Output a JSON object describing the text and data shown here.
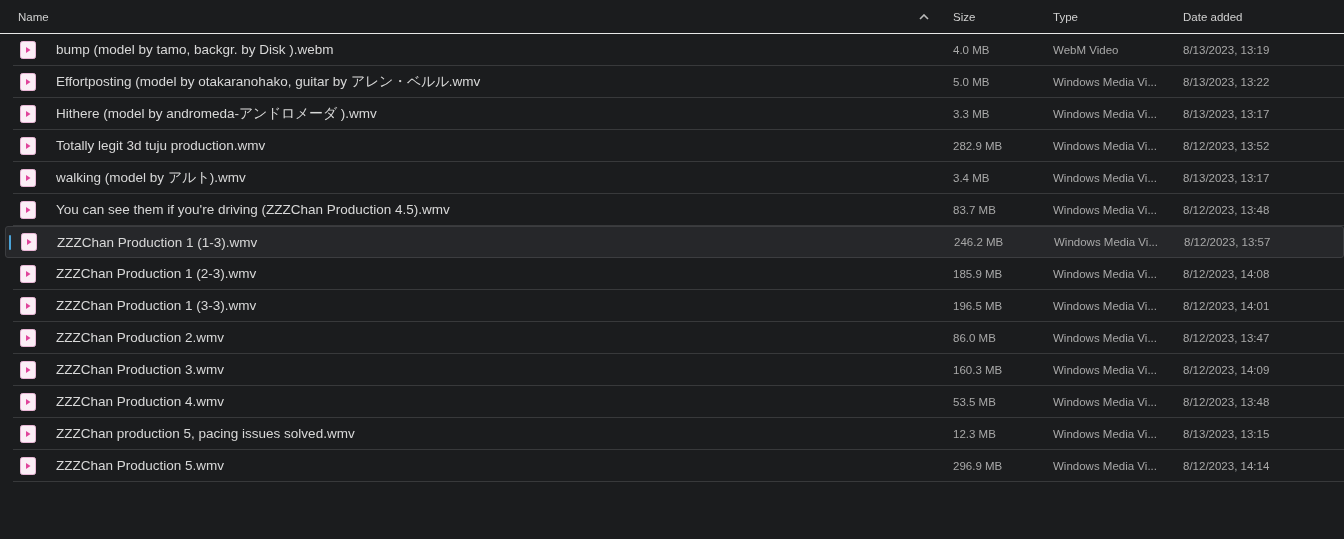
{
  "table": {
    "columns": [
      {
        "label": "Name",
        "sorted": true
      },
      {
        "label": "Size",
        "sorted": false
      },
      {
        "label": "Type",
        "sorted": false
      },
      {
        "label": "Date added",
        "sorted": false
      }
    ],
    "rows": [
      {
        "name": "bump (model by tamo, backgr. by Disk ).webm",
        "size": "4.0 MB",
        "type": "WebM Video",
        "date": "8/13/2023, 13:19",
        "selected": false
      },
      {
        "name": "Effortposting (model by otakaranohako, guitar by アレン・ベルル.wmv",
        "size": "5.0 MB",
        "type": "Windows Media Vi...",
        "date": "8/13/2023, 13:22",
        "selected": false
      },
      {
        "name": "Hithere (model by andromeda-アンドロメーダ ).wmv",
        "size": "3.3 MB",
        "type": "Windows Media Vi...",
        "date": "8/13/2023, 13:17",
        "selected": false
      },
      {
        "name": "Totally legit 3d tuju production.wmv",
        "size": "282.9 MB",
        "type": "Windows Media Vi...",
        "date": "8/12/2023, 13:52",
        "selected": false
      },
      {
        "name": "walking (model by アルト).wmv",
        "size": "3.4 MB",
        "type": "Windows Media Vi...",
        "date": "8/13/2023, 13:17",
        "selected": false
      },
      {
        "name": "You can see them if you're driving (ZZZChan Production 4.5).wmv",
        "size": "83.7 MB",
        "type": "Windows Media Vi...",
        "date": "8/12/2023, 13:48",
        "selected": false
      },
      {
        "name": "ZZZChan Production 1 (1-3).wmv",
        "size": "246.2 MB",
        "type": "Windows Media Vi...",
        "date": "8/12/2023, 13:57",
        "selected": true
      },
      {
        "name": "ZZZChan Production 1 (2-3).wmv",
        "size": "185.9 MB",
        "type": "Windows Media Vi...",
        "date": "8/12/2023, 14:08",
        "selected": false
      },
      {
        "name": "ZZZChan Production 1 (3-3).wmv",
        "size": "196.5 MB",
        "type": "Windows Media Vi...",
        "date": "8/12/2023, 14:01",
        "selected": false
      },
      {
        "name": "ZZZChan Production 2.wmv",
        "size": "86.0 MB",
        "type": "Windows Media Vi...",
        "date": "8/12/2023, 13:47",
        "selected": false
      },
      {
        "name": "ZZZChan Production 3.wmv",
        "size": "160.3 MB",
        "type": "Windows Media Vi...",
        "date": "8/12/2023, 14:09",
        "selected": false
      },
      {
        "name": "ZZZChan Production 4.wmv",
        "size": "53.5 MB",
        "type": "Windows Media Vi...",
        "date": "8/12/2023, 13:48",
        "selected": false
      },
      {
        "name": "ZZZChan production 5, pacing issues solved.wmv",
        "size": "12.3 MB",
        "type": "Windows Media Vi...",
        "date": "8/13/2023, 13:15",
        "selected": false
      },
      {
        "name": "ZZZChan Production 5.wmv",
        "size": "296.9 MB",
        "type": "Windows Media Vi...",
        "date": "8/12/2023, 14:14",
        "selected": false
      }
    ]
  }
}
